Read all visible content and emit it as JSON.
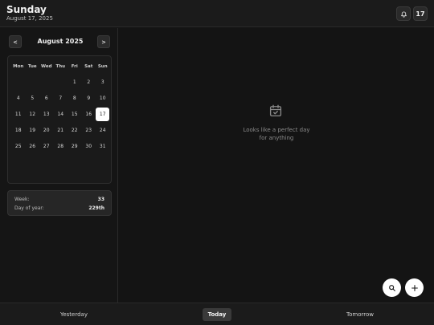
{
  "header": {
    "title": "Sunday",
    "date": "August 17, 2025",
    "day_button": "17"
  },
  "calendar": {
    "month_label": "August 2025",
    "prev_label": "<",
    "next_label": ">",
    "weekdays": [
      "Mon",
      "Tue",
      "Wed",
      "Thu",
      "Fri",
      "Sat",
      "Sun"
    ],
    "first_weekday_index": 4,
    "days_in_month": 31,
    "selected_day": 17
  },
  "stats": {
    "week_label": "Week:",
    "week_value": "33",
    "doy_label": "Day of year:",
    "doy_value": "229th"
  },
  "main": {
    "empty_line1": "Looks like a perfect day",
    "empty_line2": "for anything"
  },
  "bottom_nav": {
    "yesterday": "Yesterday",
    "today": "Today",
    "tomorrow": "Tomorrow"
  },
  "icons": {
    "bell": "bell-icon",
    "calendar_check": "calendar-check-icon",
    "search": "search-icon",
    "plus": "plus-icon"
  }
}
